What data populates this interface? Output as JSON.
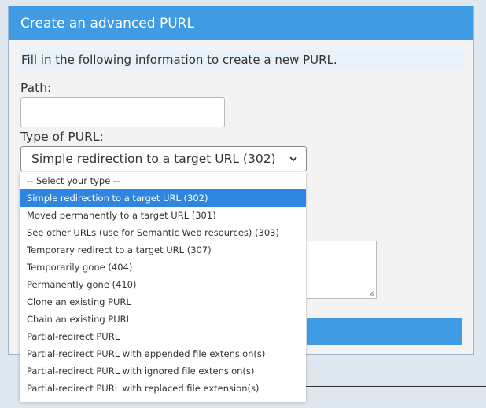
{
  "panel": {
    "title": "Create an advanced PURL",
    "info_text": "Fill in the following information to create a new PURL.",
    "path_label": "Path:",
    "path_value": "",
    "type_label": "Type of PURL:",
    "type_selected": "Simple redirection to a target URL (302)"
  },
  "dropdown": {
    "options": [
      "-- Select your type --",
      "Simple redirection to a target URL (302)",
      "Moved permanently to a target URL (301)",
      "See other URLs (use for Semantic Web resources) (303)",
      "Temporary redirect to a target URL (307)",
      "Temporarily gone (404)",
      "Permanently gone (410)",
      "Clone an existing PURL",
      "Chain an existing PURL",
      "Partial-redirect PURL",
      "Partial-redirect PURL with appended file extension(s)",
      "Partial-redirect PURL with ignored file extension(s)",
      "Partial-redirect PURL with replaced file extension(s)"
    ],
    "selected_index": 1
  },
  "colors": {
    "accent": "#3e9be4",
    "selected_option": "#2e86de"
  },
  "icons": {
    "select_arrow": "chevron-down-icon",
    "textarea_grip": "resize-grip-icon"
  }
}
